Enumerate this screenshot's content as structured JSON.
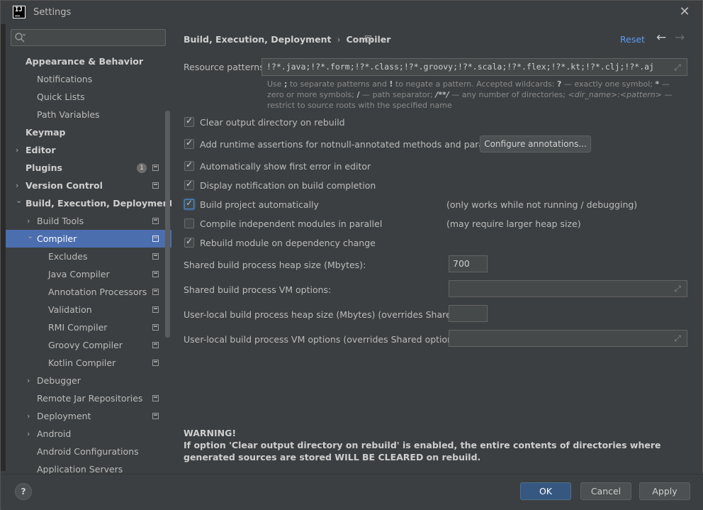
{
  "window": {
    "title": "Settings"
  },
  "sidebar": {
    "search_placeholder": "",
    "items": [
      {
        "label": "Appearance & Behavior",
        "level": 0,
        "bold": true,
        "arrow": ""
      },
      {
        "label": "Notifications",
        "level": 1,
        "bold": false,
        "arrow": ""
      },
      {
        "label": "Quick Lists",
        "level": 1,
        "bold": false,
        "arrow": ""
      },
      {
        "label": "Path Variables",
        "level": 1,
        "bold": false,
        "arrow": ""
      },
      {
        "label": "Keymap",
        "level": 0,
        "bold": true,
        "arrow": ""
      },
      {
        "label": "Editor",
        "level": 0,
        "bold": true,
        "arrow": "›"
      },
      {
        "label": "Plugins",
        "level": 0,
        "bold": true,
        "arrow": "",
        "badge": "1",
        "proj": true
      },
      {
        "label": "Version Control",
        "level": 0,
        "bold": true,
        "arrow": "›",
        "proj": true
      },
      {
        "label": "Build, Execution, Deployment",
        "level": 0,
        "bold": true,
        "arrow": "⌄"
      },
      {
        "label": "Build Tools",
        "level": 1,
        "bold": false,
        "arrow": "›",
        "proj": true
      },
      {
        "label": "Compiler",
        "level": 1,
        "bold": false,
        "arrow": "⌄",
        "proj": true,
        "selected": true
      },
      {
        "label": "Excludes",
        "level": 2,
        "bold": false,
        "arrow": "",
        "proj": true
      },
      {
        "label": "Java Compiler",
        "level": 2,
        "bold": false,
        "arrow": "",
        "proj": true
      },
      {
        "label": "Annotation Processors",
        "level": 2,
        "bold": false,
        "arrow": "",
        "proj": true
      },
      {
        "label": "Validation",
        "level": 2,
        "bold": false,
        "arrow": "",
        "proj": true
      },
      {
        "label": "RMI Compiler",
        "level": 2,
        "bold": false,
        "arrow": "",
        "proj": true
      },
      {
        "label": "Groovy Compiler",
        "level": 2,
        "bold": false,
        "arrow": "",
        "proj": true
      },
      {
        "label": "Kotlin Compiler",
        "level": 2,
        "bold": false,
        "arrow": "",
        "proj": true
      },
      {
        "label": "Debugger",
        "level": 1,
        "bold": false,
        "arrow": "›"
      },
      {
        "label": "Remote Jar Repositories",
        "level": 1,
        "bold": false,
        "arrow": "",
        "proj": true
      },
      {
        "label": "Deployment",
        "level": 1,
        "bold": false,
        "arrow": "›",
        "proj": true
      },
      {
        "label": "Android",
        "level": 1,
        "bold": false,
        "arrow": "›"
      },
      {
        "label": "Android Configurations",
        "level": 1,
        "bold": false,
        "arrow": ""
      },
      {
        "label": "Application Servers",
        "level": 1,
        "bold": false,
        "arrow": ""
      }
    ]
  },
  "header": {
    "breadcrumb_parent": "Build, Execution, Deployment",
    "breadcrumb_sep": "›",
    "breadcrumb_current": "Compiler",
    "reset": "Reset",
    "back": "←",
    "forward": "→"
  },
  "resource": {
    "label": "Resource patterns:",
    "value": "!?*.java;!?*.form;!?*.class;!?*.groovy;!?*.scala;!?*.flex;!?*.kt;!?*.clj;!?*.aj",
    "hint": {
      "p1": "Use ",
      "semi": ";",
      "p2": " to separate patterns and ",
      "bang": "!",
      "p3": " to negate a pattern. Accepted wildcards: ",
      "q": "?",
      "p4": " — exactly one symbol; ",
      "star": "*",
      "p5": " — zero or more symbols; ",
      "slash": "/",
      "p6": " — path separator; ",
      "dstar": "/**/",
      "p7": " — any number of directories; ",
      "dirname": "<dir_name>:<pattern>",
      "p8": " — restrict to source roots with the specified name"
    }
  },
  "options": {
    "clear_output": "Clear output directory on rebuild",
    "runtime_assertions": "Add runtime assertions for notnull-annotated methods and parameters",
    "configure_annotations": "Configure annotations...",
    "show_first_error": "Automatically show first error in editor",
    "display_notification": "Display notification on build completion",
    "build_auto": "Build project automatically",
    "build_auto_note": "(only works while not running / debugging)",
    "compile_parallel": "Compile independent modules in parallel",
    "compile_parallel_note": "(may require larger heap size)",
    "rebuild_dependency": "Rebuild module on dependency change"
  },
  "fields": {
    "shared_heap_label": "Shared build process heap size (Mbytes):",
    "shared_heap_value": "700",
    "shared_vm_label": "Shared build process VM options:",
    "shared_vm_value": "",
    "user_heap_label": "User-local build process heap size (Mbytes) (overrides Shared size):",
    "user_heap_value": "",
    "user_vm_label": "User-local build process VM options (overrides Shared options):",
    "user_vm_value": ""
  },
  "warning": {
    "title": "WARNING!",
    "text": "If option 'Clear output directory on rebuild' is enabled, the entire contents of directories where generated sources are stored WILL BE CLEARED on rebuild."
  },
  "footer": {
    "help": "?",
    "ok": "OK",
    "cancel": "Cancel",
    "apply": "Apply"
  }
}
